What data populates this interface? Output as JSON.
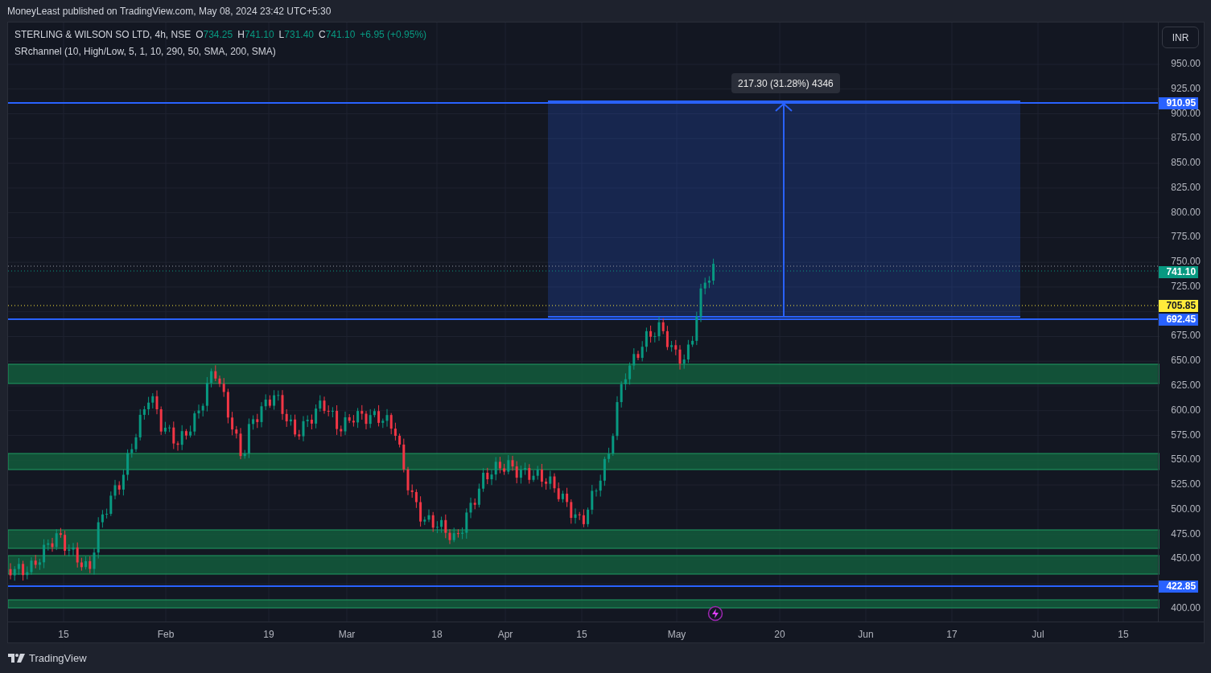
{
  "publisher_line": "MoneyLeast published on TradingView.com, May 08, 2024 23:42 UTC+5:30",
  "legend": {
    "symbol": "STERLING & WILSON SO LTD, 4h, NSE",
    "ohlc": [
      {
        "label": "O",
        "value": "734.25"
      },
      {
        "label": "H",
        "value": "741.10"
      },
      {
        "label": "L",
        "value": "731.40"
      },
      {
        "label": "C",
        "value": "741.10"
      }
    ],
    "change": "+6.95 (+0.95%)",
    "indicator": "SRchannel (10, High/Low, 5, 1, 10, 290, 50, SMA, 200, SMA)"
  },
  "currency_button": "INR",
  "measure_label": "217.30 (31.28%) 4346",
  "price_axis": [
    "950.00",
    "925.00",
    "900.00",
    "875.00",
    "850.00",
    "825.00",
    "800.00",
    "775.00",
    "750.00",
    "725.00",
    "675.00",
    "650.00",
    "625.00",
    "600.00",
    "575.00",
    "550.00",
    "525.00",
    "500.00",
    "475.00",
    "450.00",
    "400.00"
  ],
  "price_tags": [
    {
      "text": "910.95",
      "color": "#2962ff"
    },
    {
      "text": "741.10",
      "color": "#089981"
    },
    {
      "text": "705.85",
      "color": "#ffeb3b"
    },
    {
      "text": "692.45",
      "color": "#2962ff"
    },
    {
      "text": "422.85",
      "color": "#2962ff"
    }
  ],
  "time_axis": [
    "15",
    "Feb",
    "19",
    "Mar",
    "18",
    "Apr",
    "15",
    "May",
    "20",
    "Jun",
    "17",
    "Jul",
    "15"
  ],
  "footer_logo": "TradingView"
}
